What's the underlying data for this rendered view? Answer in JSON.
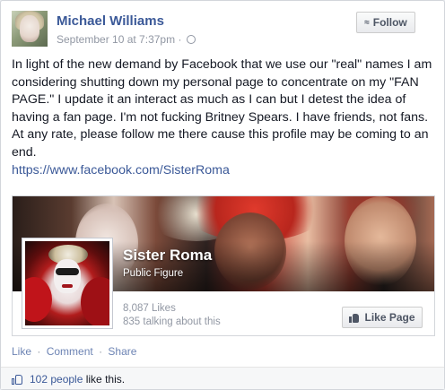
{
  "post": {
    "author": "Michael Williams",
    "timestamp": "September 10 at 7:37pm",
    "meta_separator": "·",
    "privacy_icon": "globe-icon",
    "follow_label": "Follow",
    "follow_icon": "rss-icon",
    "text": "In light of the new demand by Facebook that we use our \"real\" names I am considering shutting down my personal page to concentrate on my \"FAN PAGE.\" I update it an interact as much as I can but I detest the idea of having a fan page. I'm not fucking Britney Spears. I have friends, not fans. At any rate, please follow me there cause this profile may be coming to an end.",
    "link": "https://www.facebook.com/SisterRoma"
  },
  "attachment": {
    "page_name": "Sister Roma",
    "category": "Public Figure",
    "likes_count": "8,087 Likes",
    "talking_about": "835 talking about this",
    "like_page_label": "Like Page",
    "like_page_icon": "thumbs-up-icon"
  },
  "actions": {
    "like": "Like",
    "comment": "Comment",
    "share": "Share",
    "separator": "·"
  },
  "likes_bar": {
    "icon": "thumbs-up-icon",
    "people_link": "102 people",
    "suffix": " like this."
  },
  "colors": {
    "link_blue": "#3b5998",
    "meta_gray": "#9197a3",
    "action_blue": "#6d84b4",
    "text": "#141823"
  }
}
